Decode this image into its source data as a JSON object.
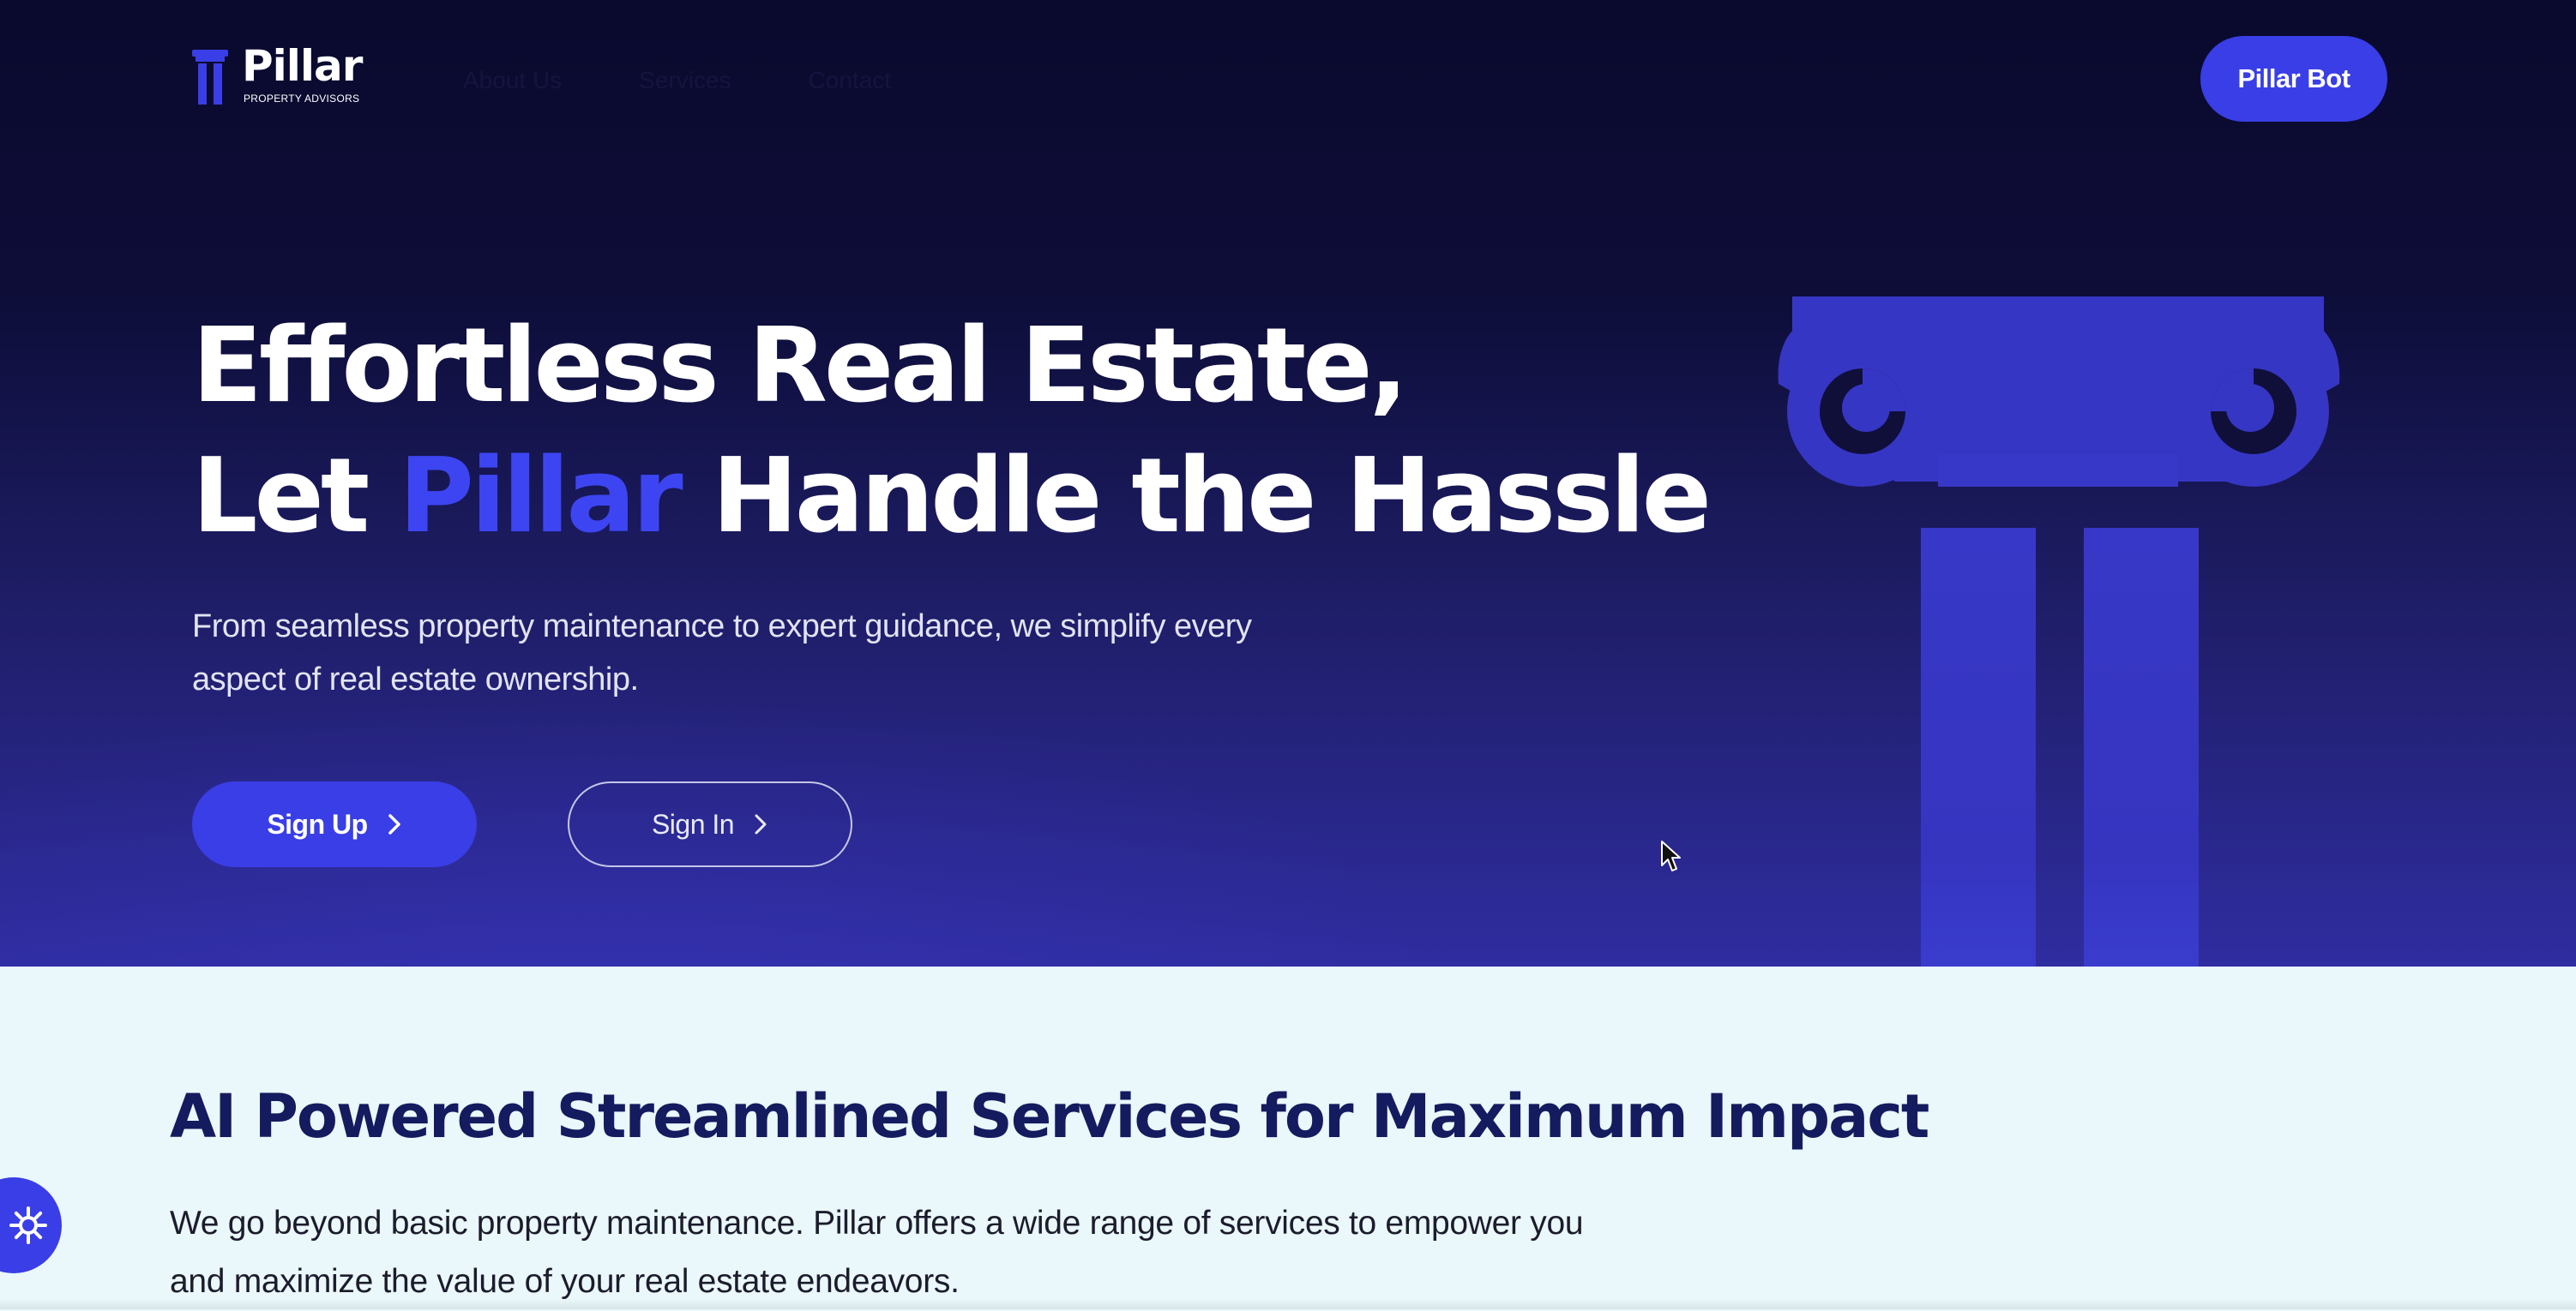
{
  "header": {
    "logo_word": "Pillar",
    "logo_sub": "PROPERTY ADVISORS",
    "nav": [
      "About Us",
      "Services",
      "Contact"
    ],
    "cta_label": "Pillar Bot"
  },
  "hero": {
    "headline_line1": "Effortless Real Estate,",
    "headline_line2_before": "Let",
    "headline_line2_accent": "Pillar",
    "headline_line2_after": "Handle the Hassle",
    "subtext": "From seamless property maintenance to expert guidance, we simplify every aspect of real estate ownership.",
    "signup_label": "Sign Up",
    "signin_label": "Sign In"
  },
  "services": {
    "title": "AI Powered Streamlined Services for Maximum Impact",
    "description": "We go beyond basic property maintenance.  Pillar offers a wide range of services to empower you and maximize the value of your real estate endeavors."
  },
  "icons": {
    "logo": "pillar-column-icon",
    "hero_art": "ionic-column-illustration",
    "chevron": "chevron-right-icon",
    "accessibility": "accessibility-gear-icon",
    "cursor": "mouse-pointer-icon"
  },
  "colors": {
    "hero_bg_top": "#0a0a2e",
    "hero_bg_bottom": "#2f2da0",
    "accent": "#3a3ee6",
    "headline_accent": "#3d45f2",
    "services_bg": "#eaf7fb",
    "services_title": "#141b5e"
  }
}
